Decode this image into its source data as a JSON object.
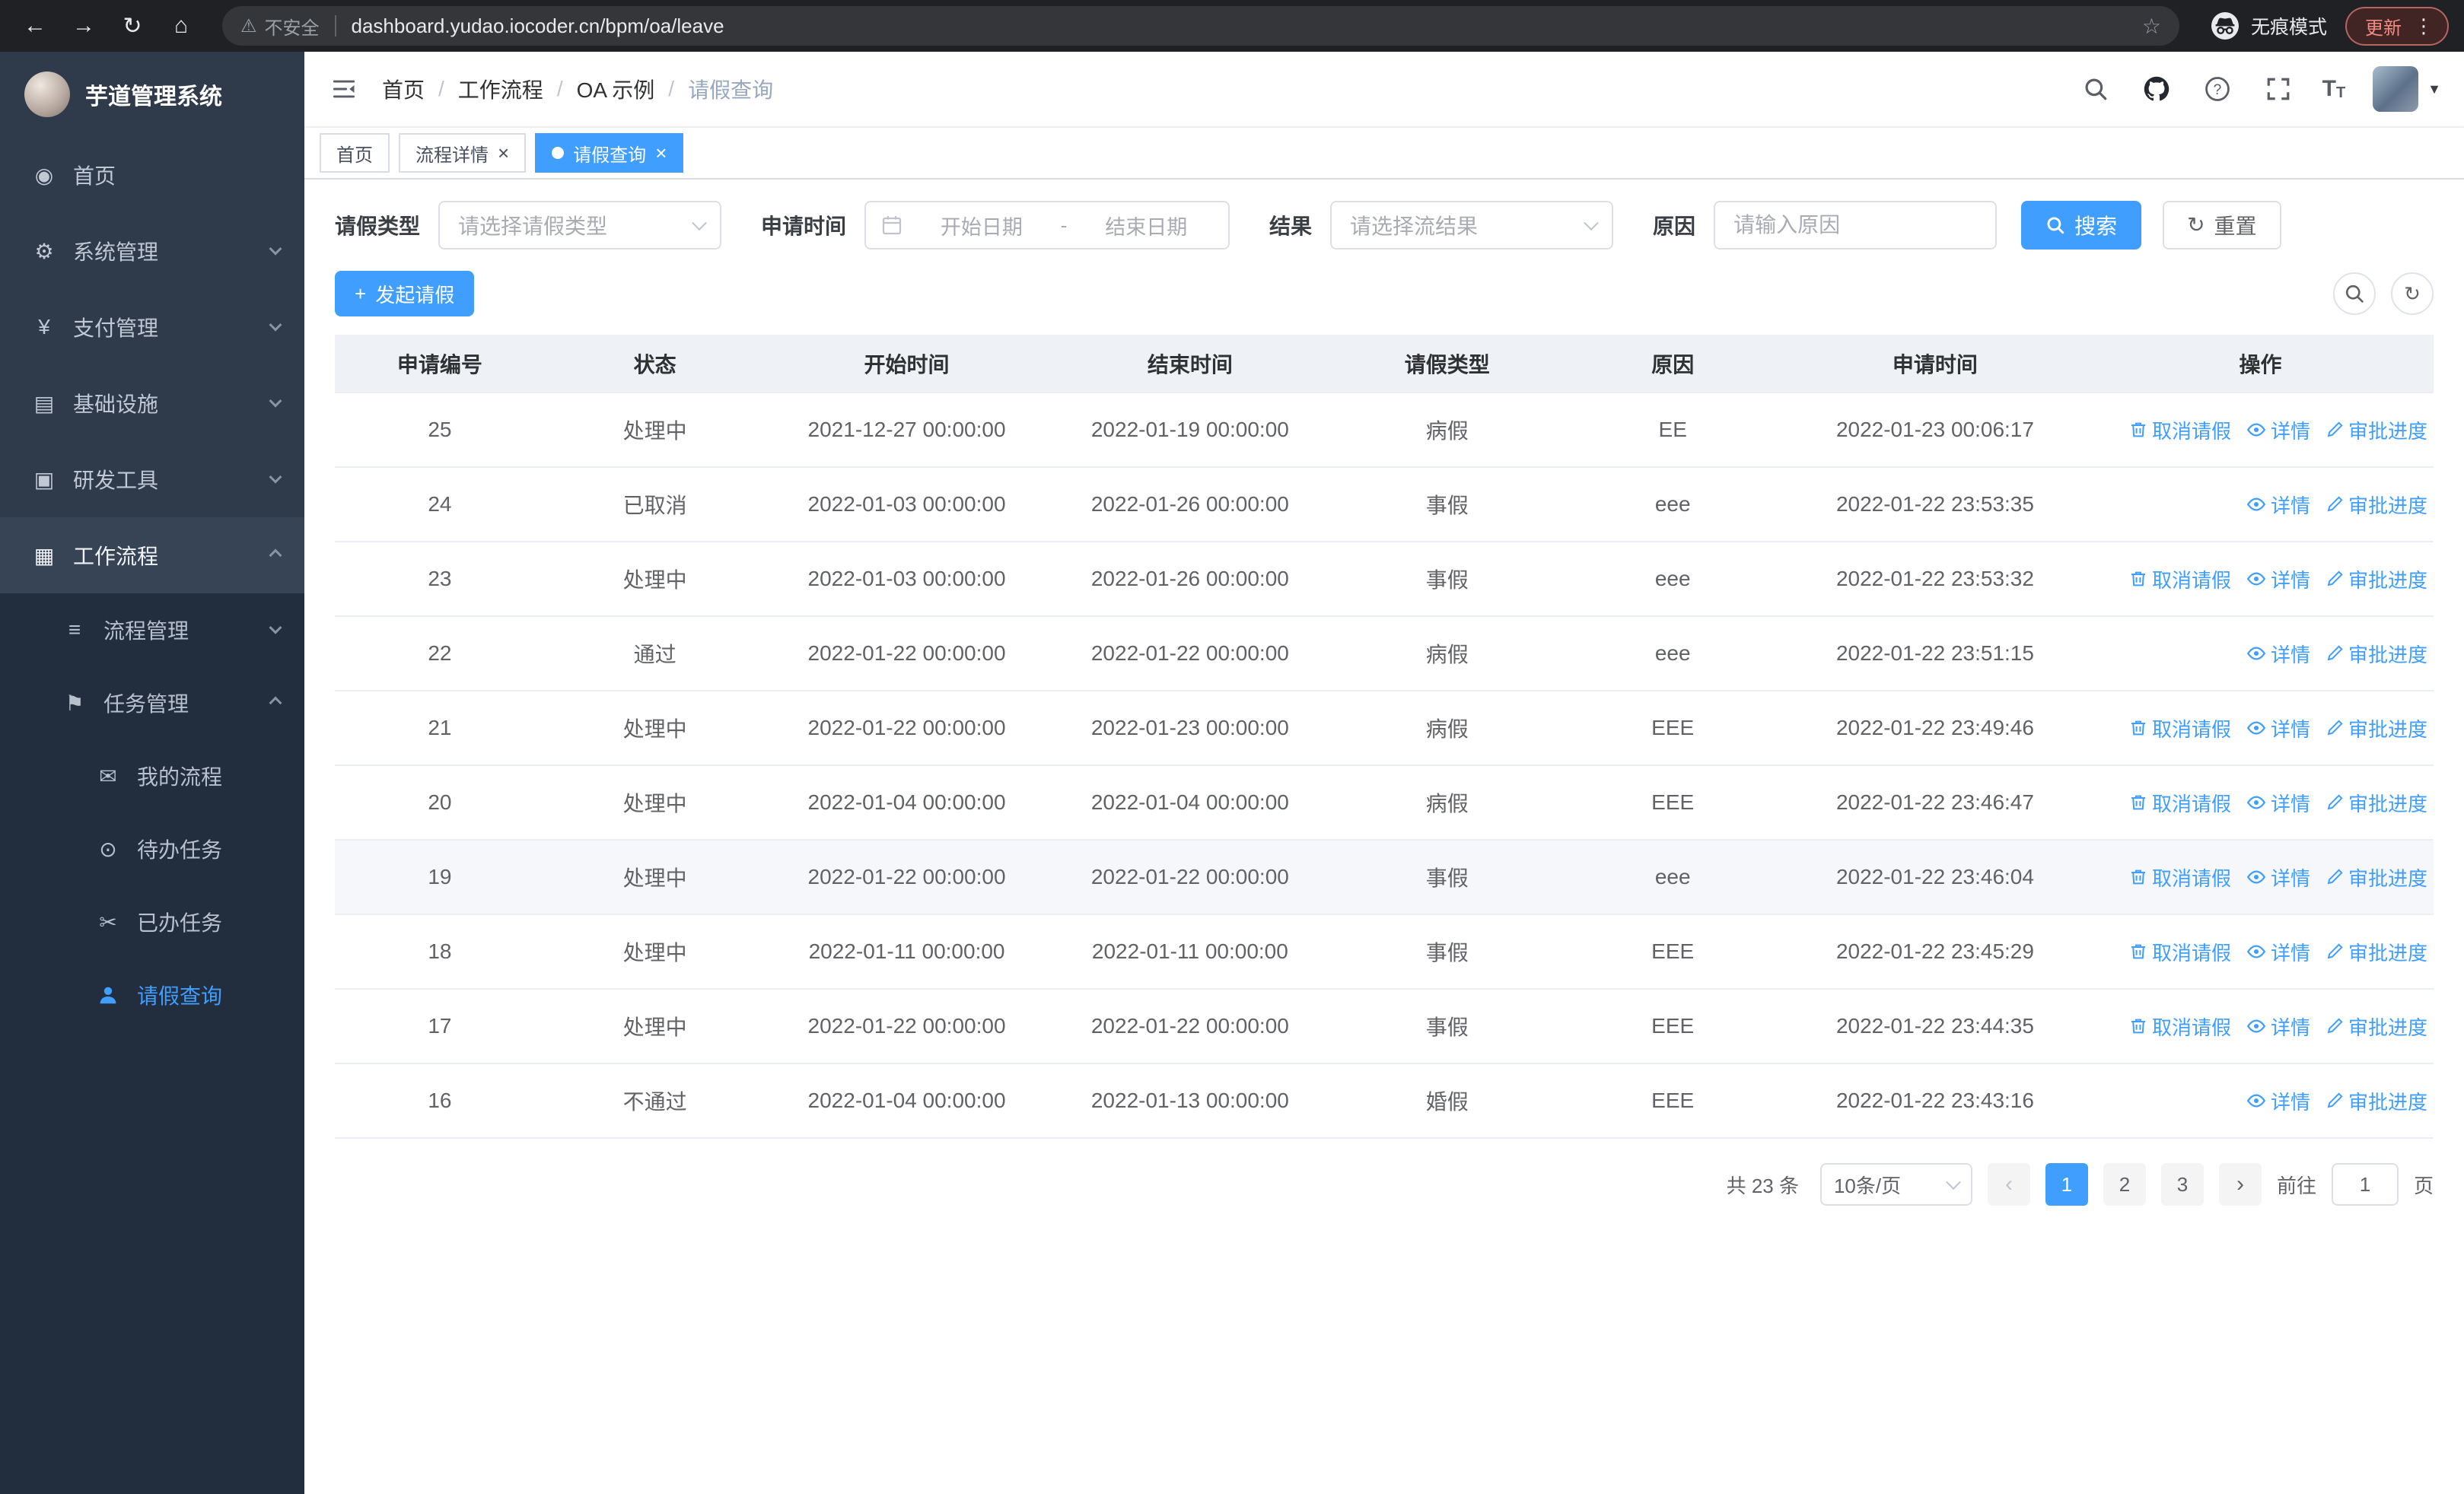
{
  "browser": {
    "security_label": "不安全",
    "url": "dashboard.yudao.iocoder.cn/bpm/oa/leave",
    "incognito_label": "无痕模式",
    "update_label": "更新"
  },
  "sidebar": {
    "logo_title": "芋道管理系统",
    "items": [
      {
        "key": "home",
        "label": "首页",
        "icon": "dashboard-icon",
        "level": 0,
        "sub": false,
        "arrow": null,
        "active": false,
        "highlight": false
      },
      {
        "key": "system",
        "label": "系统管理",
        "icon": "gear-icon",
        "level": 0,
        "sub": false,
        "arrow": "down",
        "active": false,
        "highlight": false
      },
      {
        "key": "payment",
        "label": "支付管理",
        "icon": "yen-icon",
        "level": 0,
        "sub": false,
        "arrow": "down",
        "active": false,
        "highlight": false
      },
      {
        "key": "infrastructure",
        "label": "基础设施",
        "icon": "monitor-icon",
        "level": 0,
        "sub": false,
        "arrow": "down",
        "active": false,
        "highlight": false
      },
      {
        "key": "devtools",
        "label": "研发工具",
        "icon": "tools-icon",
        "level": 0,
        "sub": false,
        "arrow": "down",
        "active": false,
        "highlight": false
      },
      {
        "key": "workflow",
        "label": "工作流程",
        "icon": "workflow-icon",
        "level": 0,
        "sub": false,
        "arrow": "up",
        "active": false,
        "highlight": true
      },
      {
        "key": "process-mgmt",
        "label": "流程管理",
        "icon": "list-icon",
        "level": 1,
        "sub": true,
        "arrow": "down",
        "active": false,
        "highlight": false
      },
      {
        "key": "task-mgmt",
        "label": "任务管理",
        "icon": "flag-icon",
        "level": 1,
        "sub": true,
        "arrow": "up",
        "active": false,
        "highlight": false
      },
      {
        "key": "my-process",
        "label": "我的流程",
        "icon": "chat-icon",
        "level": 2,
        "sub": true,
        "arrow": null,
        "active": false,
        "highlight": false
      },
      {
        "key": "todo-task",
        "label": "待办任务",
        "icon": "eye-icon",
        "level": 2,
        "sub": true,
        "arrow": null,
        "active": false,
        "highlight": false
      },
      {
        "key": "done-task",
        "label": "已办任务",
        "icon": "scissors-icon",
        "level": 2,
        "sub": true,
        "arrow": null,
        "active": false,
        "highlight": false
      },
      {
        "key": "leave-query",
        "label": "请假查询",
        "icon": "user-icon",
        "level": 2,
        "sub": true,
        "arrow": null,
        "active": true,
        "highlight": false
      }
    ]
  },
  "header": {
    "breadcrumb": [
      "首页",
      "工作流程",
      "OA 示例",
      "请假查询"
    ],
    "icons": [
      "search-icon",
      "github-icon",
      "help-icon",
      "fullscreen-icon",
      "font-size-icon",
      "avatar",
      "caret-down-icon"
    ]
  },
  "tabs": [
    {
      "key": "home",
      "label": "首页",
      "closable": false,
      "active": false
    },
    {
      "key": "process-detail",
      "label": "流程详情",
      "closable": true,
      "active": false
    },
    {
      "key": "leave-query",
      "label": "请假查询",
      "closable": true,
      "active": true
    }
  ],
  "filters": {
    "leave_type_label": "请假类型",
    "leave_type_placeholder": "请选择请假类型",
    "apply_time_label": "申请时间",
    "start_date_placeholder": "开始日期",
    "date_separator": "-",
    "end_date_placeholder": "结束日期",
    "result_label": "结果",
    "result_placeholder": "请选择流结果",
    "reason_label": "原因",
    "reason_placeholder": "请输入原因",
    "search_button": "搜索",
    "reset_button": "重置"
  },
  "toolbar": {
    "create_button": "发起请假"
  },
  "table": {
    "columns": [
      "申请编号",
      "状态",
      "开始时间",
      "结束时间",
      "请假类型",
      "原因",
      "申请时间",
      "操作"
    ],
    "op_labels": {
      "cancel": "取消请假",
      "detail": "详情",
      "progress": "审批进度"
    },
    "rows": [
      {
        "id": "25",
        "status": "处理中",
        "start": "2021-12-27 00:00:00",
        "end": "2022-01-19 00:00:00",
        "type": "病假",
        "reason": "EE",
        "applied": "2022-01-23 00:06:17",
        "ops": [
          "cancel",
          "detail",
          "progress"
        ],
        "hover": false
      },
      {
        "id": "24",
        "status": "已取消",
        "start": "2022-01-03 00:00:00",
        "end": "2022-01-26 00:00:00",
        "type": "事假",
        "reason": "eee",
        "applied": "2022-01-22 23:53:35",
        "ops": [
          "detail",
          "progress"
        ],
        "hover": false
      },
      {
        "id": "23",
        "status": "处理中",
        "start": "2022-01-03 00:00:00",
        "end": "2022-01-26 00:00:00",
        "type": "事假",
        "reason": "eee",
        "applied": "2022-01-22 23:53:32",
        "ops": [
          "cancel",
          "detail",
          "progress"
        ],
        "hover": false
      },
      {
        "id": "22",
        "status": "通过",
        "start": "2022-01-22 00:00:00",
        "end": "2022-01-22 00:00:00",
        "type": "病假",
        "reason": "eee",
        "applied": "2022-01-22 23:51:15",
        "ops": [
          "detail",
          "progress"
        ],
        "hover": false
      },
      {
        "id": "21",
        "status": "处理中",
        "start": "2022-01-22 00:00:00",
        "end": "2022-01-23 00:00:00",
        "type": "病假",
        "reason": "EEE",
        "applied": "2022-01-22 23:49:46",
        "ops": [
          "cancel",
          "detail",
          "progress"
        ],
        "hover": false
      },
      {
        "id": "20",
        "status": "处理中",
        "start": "2022-01-04 00:00:00",
        "end": "2022-01-04 00:00:00",
        "type": "病假",
        "reason": "EEE",
        "applied": "2022-01-22 23:46:47",
        "ops": [
          "cancel",
          "detail",
          "progress"
        ],
        "hover": false
      },
      {
        "id": "19",
        "status": "处理中",
        "start": "2022-01-22 00:00:00",
        "end": "2022-01-22 00:00:00",
        "type": "事假",
        "reason": "eee",
        "applied": "2022-01-22 23:46:04",
        "ops": [
          "cancel",
          "detail",
          "progress"
        ],
        "hover": true
      },
      {
        "id": "18",
        "status": "处理中",
        "start": "2022-01-11 00:00:00",
        "end": "2022-01-11 00:00:00",
        "type": "事假",
        "reason": "EEE",
        "applied": "2022-01-22 23:45:29",
        "ops": [
          "cancel",
          "detail",
          "progress"
        ],
        "hover": false
      },
      {
        "id": "17",
        "status": "处理中",
        "start": "2022-01-22 00:00:00",
        "end": "2022-01-22 00:00:00",
        "type": "事假",
        "reason": "EEE",
        "applied": "2022-01-22 23:44:35",
        "ops": [
          "cancel",
          "detail",
          "progress"
        ],
        "hover": false
      },
      {
        "id": "16",
        "status": "不通过",
        "start": "2022-01-04 00:00:00",
        "end": "2022-01-13 00:00:00",
        "type": "婚假",
        "reason": "EEE",
        "applied": "2022-01-22 23:43:16",
        "ops": [
          "detail",
          "progress"
        ],
        "hover": false
      }
    ]
  },
  "pagination": {
    "total_text": "共 23 条",
    "page_size_text": "10条/页",
    "pages": [
      "1",
      "2",
      "3"
    ],
    "active_page": "1",
    "goto_label": "前往",
    "goto_value": "1",
    "page_unit": "页"
  },
  "colors": {
    "primary": "#409eff",
    "sidebar_bg": "#2f3a4a",
    "sidebar_sub_bg": "#222d3d",
    "table_header_bg": "#eef1f6"
  }
}
